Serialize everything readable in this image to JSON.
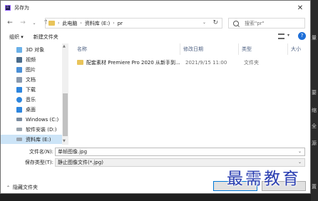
{
  "window": {
    "title": "另存为"
  },
  "nav": {
    "back": "←",
    "forward": "→",
    "up": "↑",
    "recent": "⌄"
  },
  "address": {
    "crumbs": [
      "此电脑",
      "资料库 (E:)",
      "pr"
    ],
    "sep": "›"
  },
  "search": {
    "placeholder": "搜索\"pr\""
  },
  "toolbar": {
    "organize": "组织 ▾",
    "new_folder": "新建文件夹",
    "help": "?"
  },
  "sidebar": {
    "items": [
      {
        "label": "3D 对象",
        "icon": "cube-icon",
        "color": "#6ab0e8"
      },
      {
        "label": "视频",
        "icon": "video-icon",
        "color": "#4a6b8a"
      },
      {
        "label": "图片",
        "icon": "picture-icon",
        "color": "#4a8fd6"
      },
      {
        "label": "文档",
        "icon": "document-icon",
        "color": "#8a99ad"
      },
      {
        "label": "下载",
        "icon": "download-icon",
        "color": "#2e86de"
      },
      {
        "label": "音乐",
        "icon": "music-icon",
        "color": "#2e86de"
      },
      {
        "label": "桌面",
        "icon": "desktop-icon",
        "color": "#2e86de"
      },
      {
        "label": "Windows (C:)",
        "icon": "drive-icon",
        "color": "#7a8ca0"
      },
      {
        "label": "软件安装 (D:)",
        "icon": "drive-icon",
        "color": "#9aa4ae"
      },
      {
        "label": "资料库 (E:)",
        "icon": "drive-icon",
        "color": "#9aa4ae",
        "selected": true
      }
    ]
  },
  "columns": {
    "name": "名称",
    "date": "修改日期",
    "type": "类型",
    "size": "大小"
  },
  "files": [
    {
      "name": "配套素材 Premiere Pro 2020 从新手到...",
      "date": "2021/9/15 11:00",
      "type": "文件夹"
    }
  ],
  "form": {
    "filename_label": "文件名(N):",
    "filename_value": "单帧图像.jpg",
    "filetype_label": "保存类型(T):",
    "filetype_value": "静止图像文件(*.jpg)"
  },
  "footer": {
    "hide_folders": "隐藏文件夹"
  },
  "background": {
    "chars": [
      "量",
      "要",
      "缩",
      "全",
      "源",
      "置"
    ]
  },
  "watermark": {
    "text": "最需教育"
  },
  "colors": {
    "accent": "#0078d7",
    "selection": "#cce4f7",
    "folder": "#e9c45a",
    "watermark": "#2a3eb1"
  }
}
